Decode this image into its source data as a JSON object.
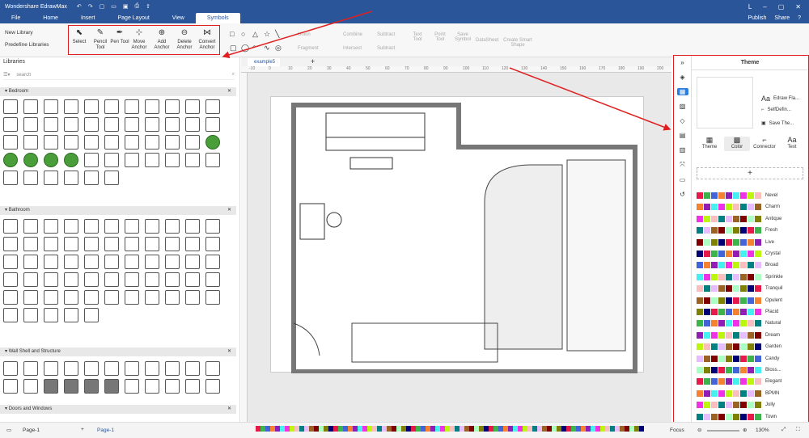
{
  "titlebar": {
    "app_name": "Wondershare EdrawMax",
    "user_initial": "L"
  },
  "menubar": {
    "items": [
      "File",
      "Home",
      "Insert",
      "Page Layout",
      "View",
      "Symbols"
    ],
    "active": "Symbols",
    "publish": "Publish",
    "share": "Share"
  },
  "ribbon": {
    "new_library": "New Library",
    "predefine_libraries": "Predefine Libraries",
    "tools": [
      {
        "label": "Select",
        "icon": "pointer"
      },
      {
        "label": "Pencil Tool",
        "icon": "pencil"
      },
      {
        "label": "Pen Tool",
        "icon": "pen"
      },
      {
        "label": "Move Anchor",
        "icon": "move-anchor"
      },
      {
        "label": "Add Anchor",
        "icon": "add-anchor"
      },
      {
        "label": "Delete Anchor",
        "icon": "delete-anchor"
      },
      {
        "label": "Convert Anchor",
        "icon": "convert-anchor"
      }
    ],
    "ops": [
      "Union",
      "Combine",
      "Subtract",
      "Fragment",
      "Intersect",
      "Subtract"
    ],
    "text_tools": [
      "Text Tool",
      "Point Tool",
      "Save Symbol",
      "DataSheet",
      "Create Smart Shape"
    ]
  },
  "libraries": {
    "title": "Libraries",
    "search_placeholder": "search",
    "sections": [
      "Bedroom",
      "Bathroom",
      "Wall Shell and Structure",
      "Doors and Windows"
    ]
  },
  "document": {
    "tab": "example5",
    "page_name": "Page-1",
    "ruler_ticks": [
      "-10",
      "0",
      "10",
      "20",
      "30",
      "40",
      "50",
      "60",
      "70",
      "80",
      "90",
      "100",
      "110",
      "120",
      "130",
      "140",
      "150",
      "160",
      "170",
      "180",
      "190",
      "200"
    ]
  },
  "theme_panel": {
    "title": "Theme",
    "options": [
      "Edraw Fla...",
      "SelfDefin...",
      "Save The..."
    ],
    "tabs": [
      "Theme",
      "Color",
      "Connector",
      "Text"
    ],
    "selected_tab": "Color",
    "themes": [
      "Nevel",
      "Charm",
      "Antique",
      "Fresh",
      "Live",
      "Crystal",
      "Broad",
      "Sprinkle",
      "Tranquil",
      "Opulent",
      "Placid",
      "Natural",
      "Dream",
      "Garden",
      "Candy",
      "Bloss...",
      "Elegant",
      "BPMN",
      "Jolly",
      "Town"
    ]
  },
  "status": {
    "page_label": "Page-1",
    "page_tab": "Page-1",
    "focus": "Focus",
    "zoom": "130%"
  },
  "colors": {
    "accent": "#2a5699",
    "highlight": "#e02020",
    "selected": "#2a7de1"
  }
}
